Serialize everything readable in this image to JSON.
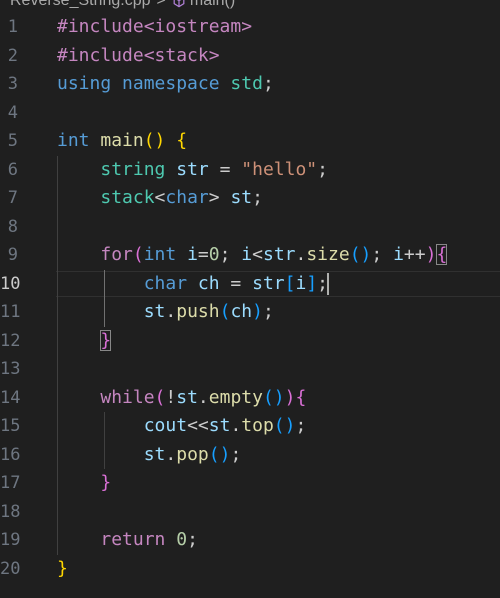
{
  "breadcrumb": {
    "file": "Reverse_String.cpp",
    "separator": ">",
    "symbol": "main()"
  },
  "editor": {
    "active_line": 10,
    "lines": [
      {
        "number": "1",
        "tokens": [
          [
            "#include<iostream>",
            "k-directive"
          ]
        ]
      },
      {
        "number": "2",
        "tokens": [
          [
            "#include<stack>",
            "k-directive"
          ]
        ]
      },
      {
        "number": "3",
        "tokens": [
          [
            "using",
            "k-using"
          ],
          [
            " ",
            "k-plain"
          ],
          [
            "namespace",
            "k-using"
          ],
          [
            " ",
            "k-plain"
          ],
          [
            "std",
            "k-ns"
          ],
          [
            ";",
            "k-plain"
          ]
        ]
      },
      {
        "number": "4",
        "tokens": []
      },
      {
        "number": "5",
        "tokens": [
          [
            "int",
            "k-type"
          ],
          [
            " ",
            "k-plain"
          ],
          [
            "main",
            "k-func"
          ],
          [
            "()",
            "b1"
          ],
          [
            " ",
            "k-plain"
          ],
          [
            "{",
            "b1"
          ]
        ]
      },
      {
        "number": "6",
        "tokens": [
          [
            "    ",
            "k-plain"
          ],
          [
            "string",
            "k-class"
          ],
          [
            " ",
            "k-plain"
          ],
          [
            "str",
            "k-var"
          ],
          [
            " = ",
            "k-plain"
          ],
          [
            "\"hello\"",
            "k-str"
          ],
          [
            ";",
            "k-plain"
          ]
        ]
      },
      {
        "number": "7",
        "tokens": [
          [
            "    ",
            "k-plain"
          ],
          [
            "stack",
            "k-class"
          ],
          [
            "<",
            "k-plain"
          ],
          [
            "char",
            "k-type"
          ],
          [
            "> ",
            "k-plain"
          ],
          [
            "st",
            "k-var"
          ],
          [
            ";",
            "k-plain"
          ]
        ]
      },
      {
        "number": "8",
        "tokens": []
      },
      {
        "number": "9",
        "tokens": [
          [
            "    ",
            "k-plain"
          ],
          [
            "for",
            "k-control"
          ],
          [
            "(",
            "b2"
          ],
          [
            "int",
            "k-type"
          ],
          [
            " ",
            "k-plain"
          ],
          [
            "i",
            "k-var"
          ],
          [
            "=",
            "k-plain"
          ],
          [
            "0",
            "k-num"
          ],
          [
            "; ",
            "k-plain"
          ],
          [
            "i",
            "k-var"
          ],
          [
            "<",
            "k-plain"
          ],
          [
            "str",
            "k-var"
          ],
          [
            ".",
            "k-plain"
          ],
          [
            "size",
            "k-func"
          ],
          [
            "()",
            "b3"
          ],
          [
            "; ",
            "k-plain"
          ],
          [
            "i",
            "k-var"
          ],
          [
            "++",
            "k-plain"
          ],
          [
            ")",
            "b2"
          ],
          [
            "{",
            "b2 bm"
          ]
        ]
      },
      {
        "number": "10",
        "tokens": [
          [
            "        ",
            "k-plain"
          ],
          [
            "char",
            "k-type"
          ],
          [
            " ",
            "k-plain"
          ],
          [
            "ch",
            "k-var"
          ],
          [
            " = ",
            "k-plain"
          ],
          [
            "str",
            "k-var"
          ],
          [
            "[",
            "b3"
          ],
          [
            "i",
            "k-var"
          ],
          [
            "]",
            "b3"
          ],
          [
            ";",
            "k-plain"
          ],
          [
            "|CURSOR|",
            "cursor"
          ]
        ]
      },
      {
        "number": "11",
        "tokens": [
          [
            "        ",
            "k-plain"
          ],
          [
            "st",
            "k-var"
          ],
          [
            ".",
            "k-plain"
          ],
          [
            "push",
            "k-func"
          ],
          [
            "(",
            "b3"
          ],
          [
            "ch",
            "k-var"
          ],
          [
            ")",
            "b3"
          ],
          [
            ";",
            "k-plain"
          ]
        ]
      },
      {
        "number": "12",
        "tokens": [
          [
            "    ",
            "k-plain"
          ],
          [
            "}",
            "b2 bm"
          ]
        ]
      },
      {
        "number": "13",
        "tokens": []
      },
      {
        "number": "14",
        "tokens": [
          [
            "    ",
            "k-plain"
          ],
          [
            "while",
            "k-control"
          ],
          [
            "(",
            "b2"
          ],
          [
            "!",
            "k-plain"
          ],
          [
            "st",
            "k-var"
          ],
          [
            ".",
            "k-plain"
          ],
          [
            "empty",
            "k-func"
          ],
          [
            "()",
            "b3"
          ],
          [
            ")",
            "b2"
          ],
          [
            "{",
            "b2"
          ]
        ]
      },
      {
        "number": "15",
        "tokens": [
          [
            "        ",
            "k-plain"
          ],
          [
            "cout",
            "k-var"
          ],
          [
            "<<",
            "k-plain"
          ],
          [
            "st",
            "k-var"
          ],
          [
            ".",
            "k-plain"
          ],
          [
            "top",
            "k-func"
          ],
          [
            "()",
            "b3"
          ],
          [
            ";",
            "k-plain"
          ]
        ]
      },
      {
        "number": "16",
        "tokens": [
          [
            "        ",
            "k-plain"
          ],
          [
            "st",
            "k-var"
          ],
          [
            ".",
            "k-plain"
          ],
          [
            "pop",
            "k-func"
          ],
          [
            "()",
            "b3"
          ],
          [
            ";",
            "k-plain"
          ]
        ]
      },
      {
        "number": "17",
        "tokens": [
          [
            "    ",
            "k-plain"
          ],
          [
            "}",
            "b2"
          ]
        ]
      },
      {
        "number": "18",
        "tokens": []
      },
      {
        "number": "19",
        "tokens": [
          [
            "    ",
            "k-plain"
          ],
          [
            "return",
            "k-control"
          ],
          [
            " ",
            "k-plain"
          ],
          [
            "0",
            "k-num"
          ],
          [
            ";",
            "k-plain"
          ]
        ]
      },
      {
        "number": "20",
        "tokens": [
          [
            "}",
            "b1"
          ]
        ]
      }
    ]
  }
}
